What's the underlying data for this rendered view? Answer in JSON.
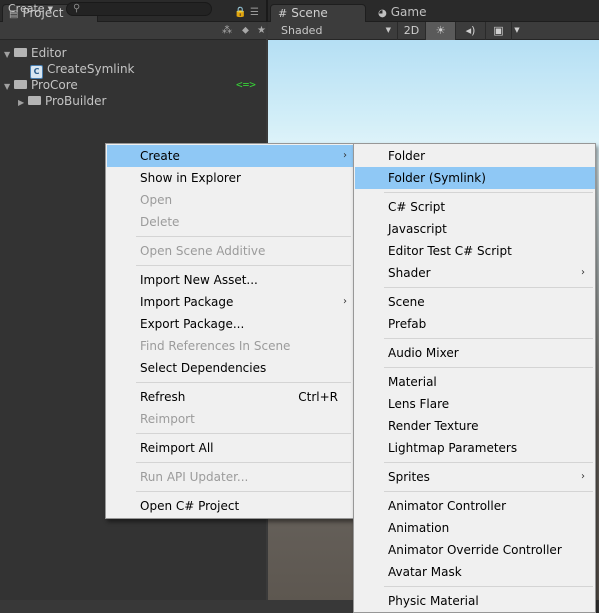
{
  "project_panel": {
    "tab_label": "Project",
    "create_label": "Create",
    "tree": [
      {
        "label": "Editor",
        "type": "folder",
        "expanded": true,
        "icon": "folder-icon"
      },
      {
        "label": "CreateSymlink",
        "type": "script",
        "icon": "cs-script-icon"
      },
      {
        "label": "ProCore",
        "type": "folder",
        "expanded": true,
        "icon": "folder-icon",
        "badge": "<=>"
      },
      {
        "label": "ProBuilder",
        "type": "folder",
        "expanded": false,
        "icon": "folder-icon"
      }
    ]
  },
  "scene_panel": {
    "tabs": [
      {
        "label": "Scene",
        "icon": "grid-icon",
        "active": true
      },
      {
        "label": "Game",
        "icon": "pacman-icon",
        "active": false
      }
    ],
    "shading_mode": "Shaded",
    "mode_2d_label": "2D"
  },
  "context_menu": {
    "items": [
      {
        "label": "Create",
        "enabled": true,
        "submenu": true,
        "highlighted": true
      },
      {
        "label": "Show in Explorer",
        "enabled": true
      },
      {
        "label": "Open",
        "enabled": false
      },
      {
        "label": "Delete",
        "enabled": false
      },
      {
        "separator": true
      },
      {
        "label": "Open Scene Additive",
        "enabled": false
      },
      {
        "separator": true
      },
      {
        "label": "Import New Asset...",
        "enabled": true
      },
      {
        "label": "Import Package",
        "enabled": true,
        "submenu": true
      },
      {
        "label": "Export Package...",
        "enabled": true
      },
      {
        "label": "Find References In Scene",
        "enabled": false
      },
      {
        "label": "Select Dependencies",
        "enabled": true
      },
      {
        "separator": true
      },
      {
        "label": "Refresh",
        "enabled": true,
        "shortcut": "Ctrl+R"
      },
      {
        "label": "Reimport",
        "enabled": false
      },
      {
        "separator": true
      },
      {
        "label": "Reimport All",
        "enabled": true
      },
      {
        "separator": true
      },
      {
        "label": "Run API Updater...",
        "enabled": false
      },
      {
        "separator": true
      },
      {
        "label": "Open C# Project",
        "enabled": true
      }
    ]
  },
  "create_submenu": {
    "items": [
      {
        "label": "Folder",
        "enabled": true
      },
      {
        "label": "Folder (Symlink)",
        "enabled": true,
        "highlighted": true
      },
      {
        "separator": true
      },
      {
        "label": "C# Script",
        "enabled": true
      },
      {
        "label": "Javascript",
        "enabled": true
      },
      {
        "label": "Editor Test C# Script",
        "enabled": true
      },
      {
        "label": "Shader",
        "enabled": true,
        "submenu": true
      },
      {
        "separator": true
      },
      {
        "label": "Scene",
        "enabled": true
      },
      {
        "label": "Prefab",
        "enabled": true
      },
      {
        "separator": true
      },
      {
        "label": "Audio Mixer",
        "enabled": true
      },
      {
        "separator": true
      },
      {
        "label": "Material",
        "enabled": true
      },
      {
        "label": "Lens Flare",
        "enabled": true
      },
      {
        "label": "Render Texture",
        "enabled": true
      },
      {
        "label": "Lightmap Parameters",
        "enabled": true
      },
      {
        "separator": true
      },
      {
        "label": "Sprites",
        "enabled": true,
        "submenu": true
      },
      {
        "separator": true
      },
      {
        "label": "Animator Controller",
        "enabled": true
      },
      {
        "label": "Animation",
        "enabled": true
      },
      {
        "label": "Animator Override Controller",
        "enabled": true
      },
      {
        "label": "Avatar Mask",
        "enabled": true
      },
      {
        "separator": true
      },
      {
        "label": "Physic Material",
        "enabled": true
      }
    ]
  },
  "colors": {
    "menu_bg": "#f0f0f0",
    "menu_highlight": "#8fc8f5",
    "disabled_text": "#9b9b9b",
    "symlink_badge": "#37d337"
  }
}
